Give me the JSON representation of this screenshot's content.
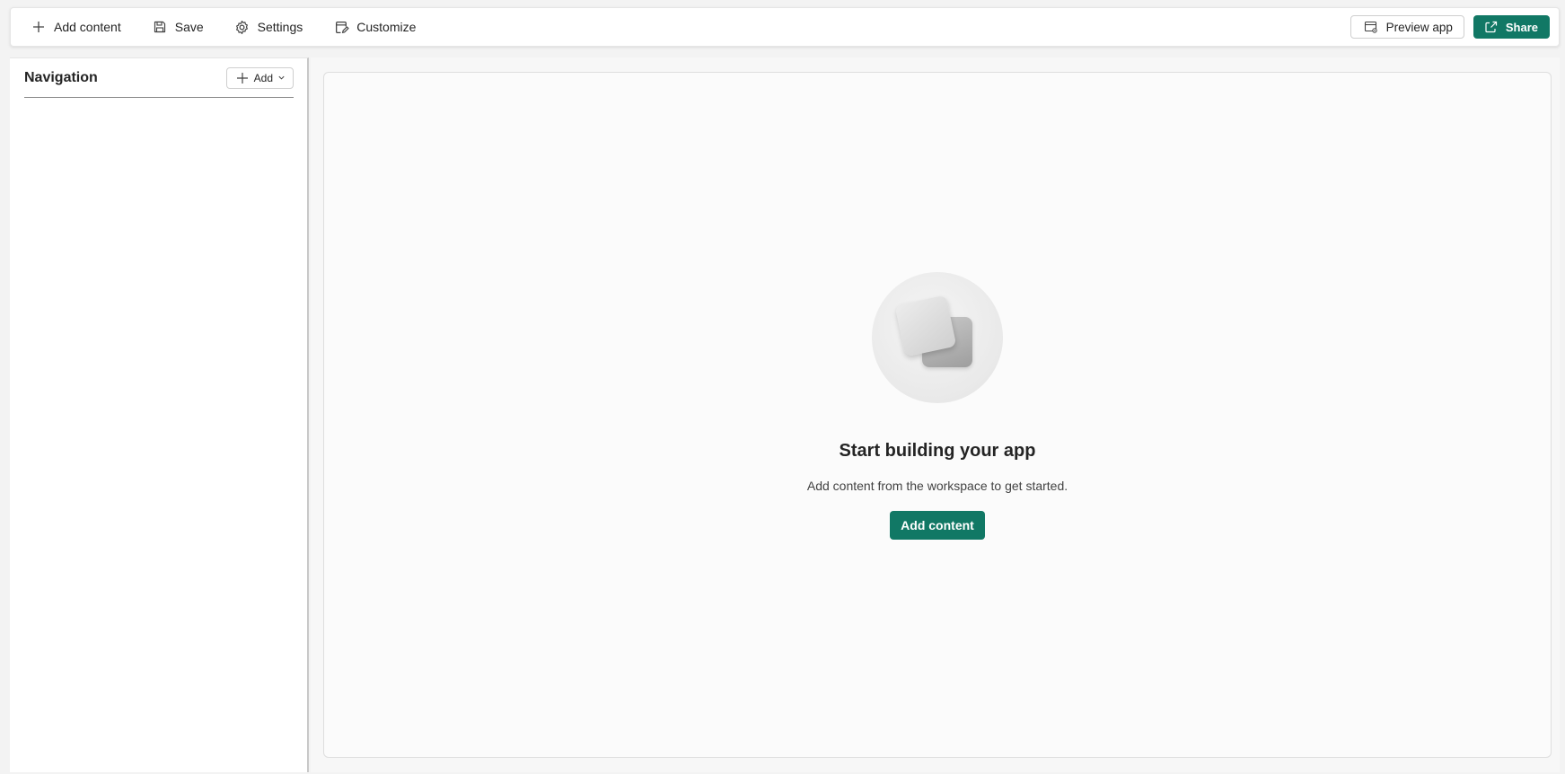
{
  "toolbar": {
    "add_content_label": "Add content",
    "save_label": "Save",
    "settings_label": "Settings",
    "customize_label": "Customize",
    "preview_label": "Preview app",
    "share_label": "Share"
  },
  "navigation": {
    "title": "Navigation",
    "add_label": "Add"
  },
  "empty_state": {
    "title": "Start building your app",
    "subtitle": "Add content from the workspace to get started.",
    "button_label": "Add content"
  },
  "colors": {
    "accent": "#117865",
    "background": "#f3f3f3"
  },
  "icons": [
    "plus-icon",
    "save-icon",
    "gear-icon",
    "customize-icon",
    "preview-icon",
    "share-icon",
    "chevron-down-icon"
  ]
}
